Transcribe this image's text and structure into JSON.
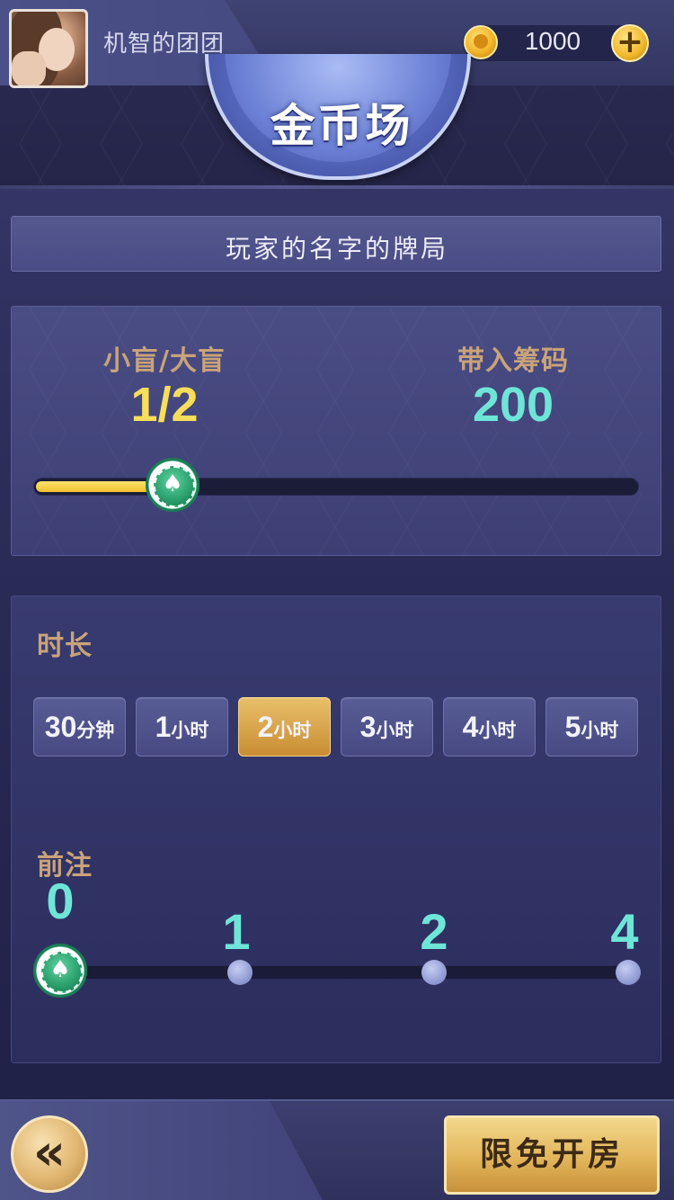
{
  "user": {
    "name": "机智的团团",
    "coins": "1000"
  },
  "header": {
    "title": "金币场",
    "add_label": "+"
  },
  "room": {
    "name": "玩家的名字的牌局"
  },
  "blinds": {
    "label": "小盲/大盲",
    "value": "1/2",
    "buyin_label": "带入筹码",
    "buyin_value": "200",
    "slider_fraction": 0.23
  },
  "duration": {
    "label": "时长",
    "options": [
      {
        "num": "30",
        "unit": "分钟"
      },
      {
        "num": "1",
        "unit": "小时"
      },
      {
        "num": "2",
        "unit": "小时"
      },
      {
        "num": "3",
        "unit": "小时"
      },
      {
        "num": "4",
        "unit": "小时"
      },
      {
        "num": "5",
        "unit": "小时"
      }
    ],
    "selected_index": 2
  },
  "ante": {
    "label": "前注",
    "values": [
      "0",
      "1",
      "2",
      "4"
    ],
    "selected_index": 0
  },
  "footer": {
    "back_label": "«",
    "create_label": "限免开房"
  },
  "icons": {
    "chip": "spade-chip-icon",
    "coin": "coin-icon",
    "back": "double-chevron-left-icon"
  },
  "colors": {
    "gold_text": "#c9a37a",
    "yellow_value": "#f6de5a",
    "teal_value": "#6fe5d8",
    "active_button": "#e2b55b"
  }
}
